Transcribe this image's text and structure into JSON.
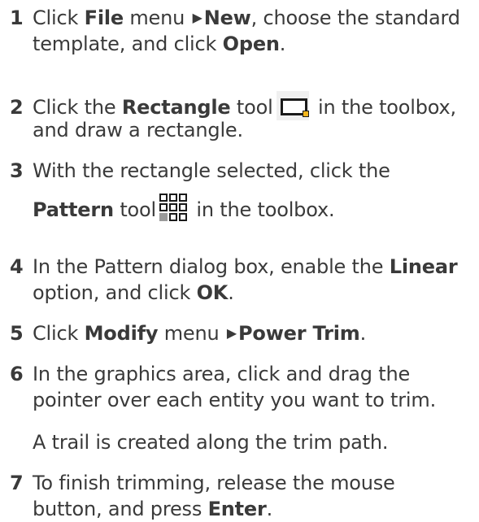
{
  "steps": [
    {
      "num": "1",
      "l1a": "Click ",
      "l1b": "File",
      "l1c": " menu ",
      "l1d": "New",
      "l1e": ", choose the standard",
      "l2a": "template, and click ",
      "l2b": "Open",
      "l2c": "."
    },
    {
      "num": "2",
      "l1a": "Click the ",
      "l1b": "Rectangle",
      "l1c": " tool",
      "l1d": " in the toolbox,",
      "l2a": "and draw a rectangle."
    },
    {
      "num": "3",
      "l1a": "With the rectangle selected, click the",
      "l2a": "Pattern",
      "l2b": " tool",
      "l2c": " in the toolbox."
    },
    {
      "num": "4",
      "l1a": "In the Pattern dialog box, enable the ",
      "l1b": "Linear",
      "l2a": "option, and click ",
      "l2b": "OK",
      "l2c": "."
    },
    {
      "num": "5",
      "l1a": "Click ",
      "l1b": "Modify",
      "l1c": " menu ",
      "l1d": "Power Trim",
      "l1e": "."
    },
    {
      "num": "6",
      "l1a": "In the graphics area, click and drag the",
      "l2a": "pointer over each entity you want to trim.",
      "note": "A trail is created along the trim path."
    },
    {
      "num": "7",
      "l1a": "To finish trimming, release the mouse",
      "l2a": "button, and press ",
      "l2b": "Enter",
      "l2c": "."
    }
  ],
  "icons": {
    "menu_arrow": "triangle-right-icon",
    "rectangle_tool": "rectangle-tool-icon",
    "pattern_tool": "pattern-tool-icon"
  },
  "colors": {
    "text": "#3a3a3a",
    "handle": "#f3b51b",
    "tool_bg": "#f0f0f0"
  }
}
